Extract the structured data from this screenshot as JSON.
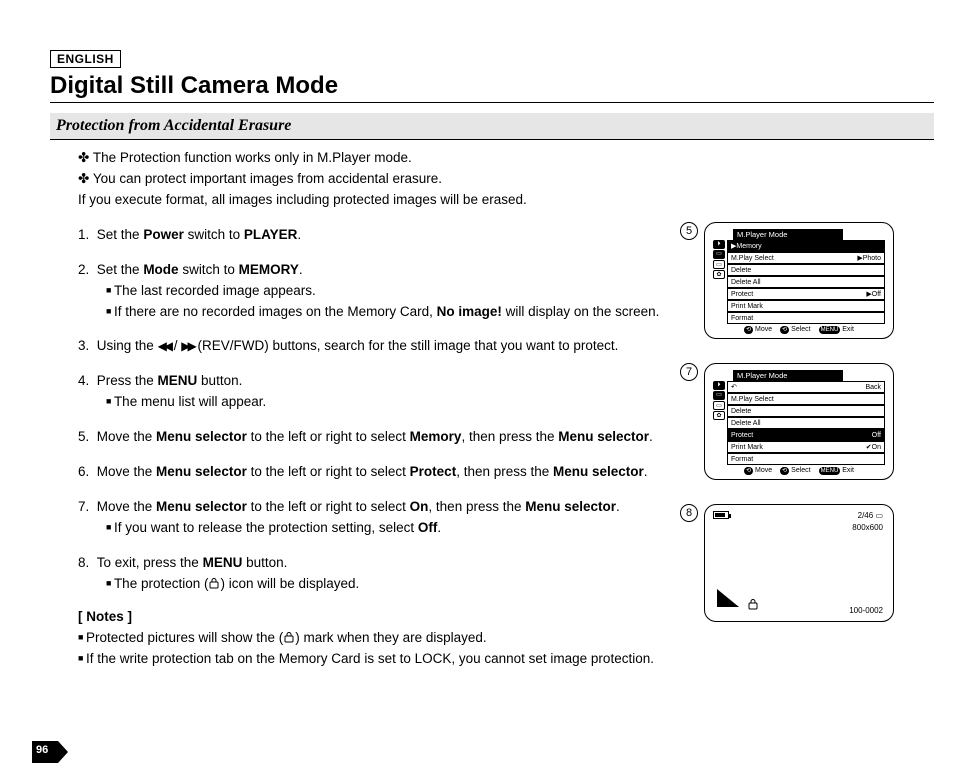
{
  "lang": "ENGLISH",
  "title": "Digital Still Camera Mode",
  "subtitle": "Protection from Accidental Erasure",
  "intro": {
    "l1": "The Protection function works only in M.Player mode.",
    "l2": "You can protect important images from accidental erasure.",
    "l3": "If you execute format, all images including protected images will be erased."
  },
  "steps": {
    "s1a": "Set the ",
    "s1b": "Power",
    "s1c": " switch to ",
    "s1d": "PLAYER",
    "s1e": ".",
    "s2a": "Set the ",
    "s2b": "Mode",
    "s2c": " switch to ",
    "s2d": "MEMORY",
    "s2e": ".",
    "s2sub1": "The last recorded image appears.",
    "s2sub2a": "If there are no recorded images on the Memory Card, ",
    "s2sub2b": "No image!",
    "s2sub2c": " will display on the screen.",
    "s3a": "Using the ",
    "s3b": " / ",
    "s3c": " (REV/FWD) buttons, search for the still image that you want to protect.",
    "s4a": "Press the ",
    "s4b": "MENU",
    "s4c": " button.",
    "s4sub1": "The menu list will appear.",
    "s5a": "Move the ",
    "s5b": "Menu selector",
    "s5c": " to the left or right to select ",
    "s5d": "Memory",
    "s5e": ", then press the ",
    "s5f": "Menu selector",
    "s5g": ".",
    "s6a": "Move the ",
    "s6b": "Menu selector",
    "s6c": " to the left or right to select ",
    "s6d": "Protect",
    "s6e": ", then press the ",
    "s6f": "Menu selector",
    "s6g": ".",
    "s7a": "Move the ",
    "s7b": "Menu selector",
    "s7c": " to the left or right to select ",
    "s7d": "On",
    "s7e": ", then press the ",
    "s7f": "Menu selector",
    "s7g": ".",
    "s7sub1a": "If you want to release the protection setting, select ",
    "s7sub1b": "Off",
    "s7sub1c": ".",
    "s8a": "To exit, press the ",
    "s8b": "MENU",
    "s8c": " button.",
    "s8sub1a": "The protection (",
    "s8sub1b": ") icon will be displayed."
  },
  "notesHdr": "[ Notes ]",
  "notes": {
    "n1a": "Protected pictures will show the (",
    "n1b": ") mark when they are displayed.",
    "n2": "If the write protection tab on the Memory Card is set to LOCK, you cannot set image protection."
  },
  "panel5": {
    "num": "5",
    "title": "M.Player Mode",
    "hl": "▶Memory",
    "items": [
      "M.Play Select",
      "Delete",
      "Delete All",
      "Protect",
      "Print Mark",
      "Format"
    ],
    "right1": "▶Photo",
    "right2": "▶Off",
    "ctrlMove": "Move",
    "ctrlSelect": "Select",
    "ctrlExit": "Exit",
    "menuLbl": "MENU"
  },
  "panel7": {
    "num": "7",
    "title": "M.Player Mode",
    "back": "Back",
    "items": [
      "M.Play Select",
      "Delete",
      "Delete All",
      "Protect",
      "Print Mark",
      "Format"
    ],
    "protectVal": "Off",
    "onVal": "✔On",
    "ctrlMove": "Move",
    "ctrlSelect": "Select",
    "ctrlExit": "Exit",
    "menuLbl": "MENU"
  },
  "panel8": {
    "num": "8",
    "counter": "2/46",
    "res": "800x600",
    "file": "100-0002"
  },
  "pageNum": "96"
}
